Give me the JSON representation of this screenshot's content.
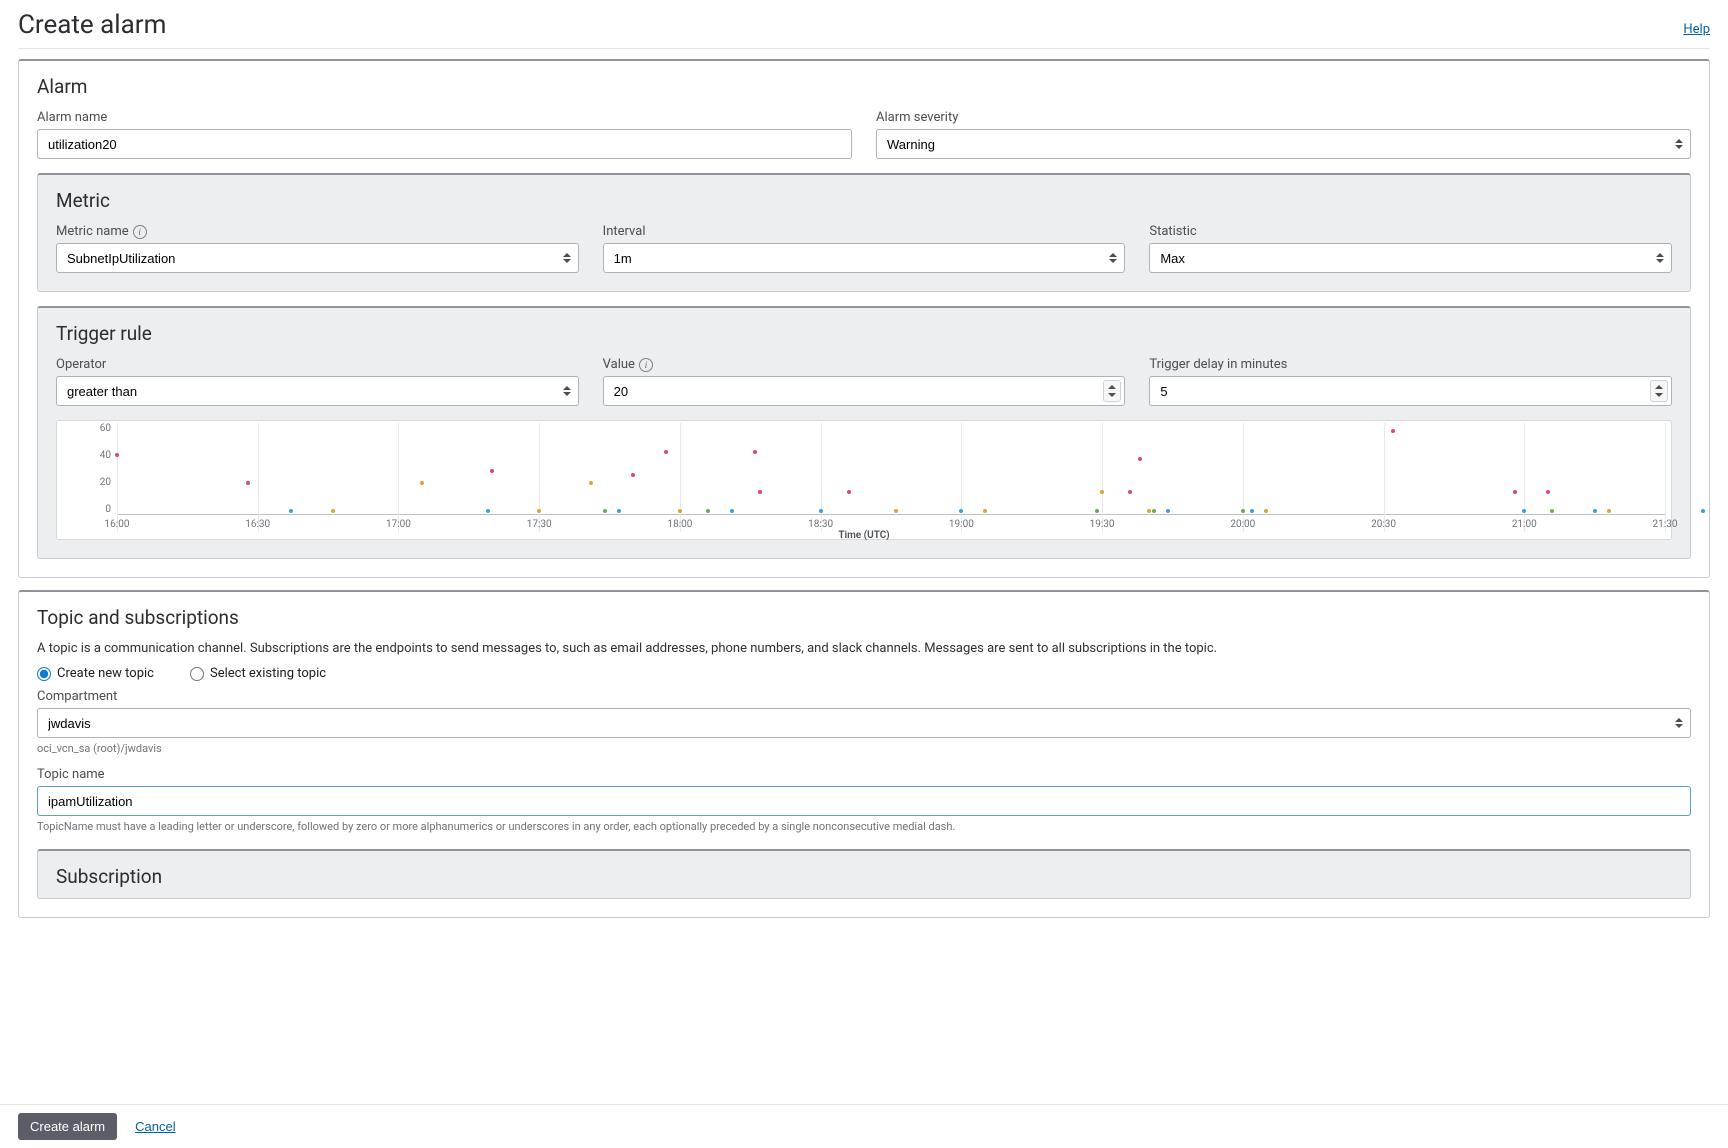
{
  "header": {
    "title": "Create alarm",
    "help_label": "Help"
  },
  "alarm": {
    "section_title": "Alarm",
    "name_label": "Alarm name",
    "name_value": "utilization20",
    "severity_label": "Alarm severity",
    "severity_value": "Warning"
  },
  "metric": {
    "section_title": "Metric",
    "name_label": "Metric name",
    "name_value": "SubnetIpUtilization",
    "interval_label": "Interval",
    "interval_value": "1m",
    "statistic_label": "Statistic",
    "statistic_value": "Max"
  },
  "trigger": {
    "section_title": "Trigger rule",
    "operator_label": "Operator",
    "operator_value": "greater than",
    "value_label": "Value",
    "value_value": "20",
    "delay_label": "Trigger delay in minutes",
    "delay_value": "5"
  },
  "chart_data": {
    "type": "scatter",
    "xlabel": "Time (UTC)",
    "x_ticks": [
      "16:00",
      "16:30",
      "17:00",
      "17:30",
      "18:00",
      "18:30",
      "19:00",
      "19:30",
      "20:00",
      "20:30",
      "21:00",
      "21:30"
    ],
    "y_ticks": [
      0,
      20,
      40,
      60
    ],
    "ylim": [
      0,
      65
    ],
    "points": [
      {
        "x": "16:00",
        "y": 42,
        "c": "#d64a7a"
      },
      {
        "x": "16:28",
        "y": 22,
        "c": "#d64a7a"
      },
      {
        "x": "16:37",
        "y": 2,
        "c": "#3aa0e0"
      },
      {
        "x": "16:46",
        "y": 2,
        "c": "#e0a23a"
      },
      {
        "x": "17:05",
        "y": 22,
        "c": "#e0a23a"
      },
      {
        "x": "17:19",
        "y": 2,
        "c": "#3aa0e0"
      },
      {
        "x": "17:20",
        "y": 31,
        "c": "#d64a7a"
      },
      {
        "x": "17:30",
        "y": 2,
        "c": "#e0a23a"
      },
      {
        "x": "17:41",
        "y": 22,
        "c": "#e0a23a"
      },
      {
        "x": "17:44",
        "y": 2,
        "c": "#6fa84f"
      },
      {
        "x": "17:47",
        "y": 2,
        "c": "#3aa0e0"
      },
      {
        "x": "17:50",
        "y": 28,
        "c": "#d64a7a"
      },
      {
        "x": "17:57",
        "y": 44,
        "c": "#d64a7a"
      },
      {
        "x": "18:00",
        "y": 2,
        "c": "#e0a23a"
      },
      {
        "x": "18:06",
        "y": 2,
        "c": "#6fa84f"
      },
      {
        "x": "18:11",
        "y": 2,
        "c": "#3aa0e0"
      },
      {
        "x": "18:16",
        "y": 44,
        "c": "#d64a7a"
      },
      {
        "x": "18:17",
        "y": 16,
        "c": "#d64a7a"
      },
      {
        "x": "18:30",
        "y": 2,
        "c": "#3aa0e0"
      },
      {
        "x": "18:36",
        "y": 16,
        "c": "#d64a7a"
      },
      {
        "x": "18:46",
        "y": 2,
        "c": "#e0a23a"
      },
      {
        "x": "19:00",
        "y": 2,
        "c": "#3aa0e0"
      },
      {
        "x": "19:05",
        "y": 2,
        "c": "#e0a23a"
      },
      {
        "x": "19:29",
        "y": 2,
        "c": "#6fa84f"
      },
      {
        "x": "19:30",
        "y": 16,
        "c": "#e0a23a"
      },
      {
        "x": "19:36",
        "y": 16,
        "c": "#d64a7a"
      },
      {
        "x": "19:38",
        "y": 39,
        "c": "#d64a7a"
      },
      {
        "x": "19:40",
        "y": 2,
        "c": "#e0a23a"
      },
      {
        "x": "19:41",
        "y": 2,
        "c": "#6fa84f"
      },
      {
        "x": "19:44",
        "y": 2,
        "c": "#3aa0e0"
      },
      {
        "x": "20:00",
        "y": 2,
        "c": "#6fa84f"
      },
      {
        "x": "20:02",
        "y": 2,
        "c": "#3aa0e0"
      },
      {
        "x": "20:05",
        "y": 2,
        "c": "#e0a23a"
      },
      {
        "x": "20:32",
        "y": 59,
        "c": "#d64a7a"
      },
      {
        "x": "20:58",
        "y": 16,
        "c": "#d64a7a"
      },
      {
        "x": "21:00",
        "y": 2,
        "c": "#3aa0e0"
      },
      {
        "x": "21:05",
        "y": 16,
        "c": "#d64a7a"
      },
      {
        "x": "21:06",
        "y": 2,
        "c": "#6fa84f"
      },
      {
        "x": "21:15",
        "y": 2,
        "c": "#3aa0e0"
      },
      {
        "x": "21:18",
        "y": 2,
        "c": "#e0a23a"
      },
      {
        "x": "21:38",
        "y": 2,
        "c": "#3aa0e0"
      }
    ]
  },
  "topic": {
    "section_title": "Topic and subscriptions",
    "description": "A topic is a communication channel. Subscriptions are the endpoints to send messages to, such as email addresses, phone numbers, and slack channels. Messages are sent to all subscriptions in the topic.",
    "create_label": "Create new topic",
    "select_label": "Select existing topic",
    "compartment_label": "Compartment",
    "compartment_value": "jwdavis",
    "compartment_path": "oci_vcn_sa (root)/jwdavis",
    "topic_name_label": "Topic name",
    "topic_name_value": "ipamUtilization",
    "topic_name_help": "TopicName must have a leading letter or underscore, followed by zero or more alphanumerics or underscores in any order, each optionally preceded by a single nonconsecutive medial dash."
  },
  "subscription": {
    "section_title": "Subscription"
  },
  "footer": {
    "create_label": "Create alarm",
    "cancel_label": "Cancel"
  }
}
